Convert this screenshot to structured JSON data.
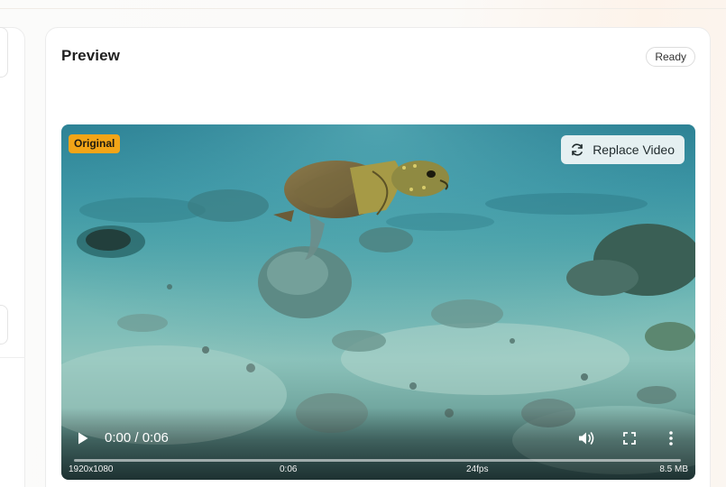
{
  "preview": {
    "title": "Preview",
    "status": "Ready"
  },
  "video": {
    "badge": "Original",
    "replace_label": "Replace Video",
    "time_display": "0:00 / 0:06",
    "progress": 0,
    "meta": {
      "resolution": "1920x1080",
      "duration": "0:06",
      "fps": "24fps",
      "size": "8.5 MB"
    }
  },
  "icons": {
    "replace": "refresh-icon",
    "play": "play-icon",
    "volume": "volume-icon",
    "fullscreen": "fullscreen-icon",
    "more": "more-vertical-icon"
  },
  "colors": {
    "badge_bg": "#f3a517",
    "water_top": "#2a7f93",
    "sand": "#8cc3bb"
  }
}
